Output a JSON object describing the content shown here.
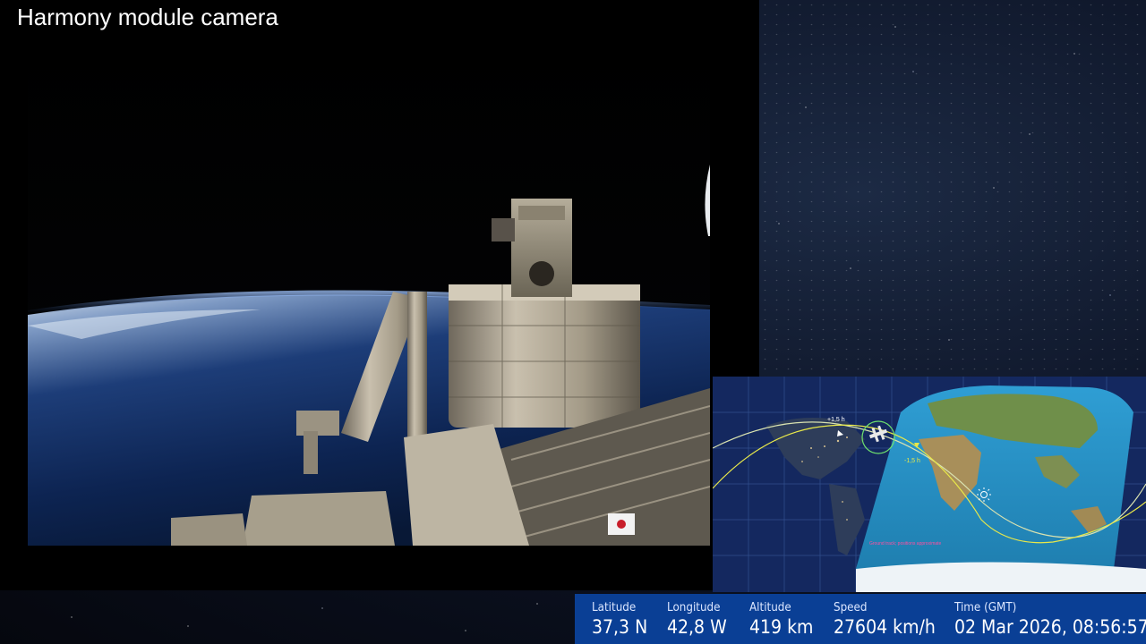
{
  "camera": {
    "title": "Harmony module camera"
  },
  "map": {
    "orbit_marker_ahead": "+1,5 h",
    "orbit_marker_behind": "-1,5 h",
    "footer_note": "Ground track; positions approximate",
    "colors": {
      "ocean_night": "#14285f",
      "ocean_day": "#2a8ec0",
      "past_track": "#d9e2b0",
      "future_track": "#e8e84a",
      "station_ring": "#6ee06e"
    },
    "icons": [
      "station-icon",
      "sun-icon"
    ]
  },
  "telemetry": {
    "latitude_label": "Latitude",
    "latitude_value": "37,3 N",
    "longitude_label": "Longitude",
    "longitude_value": "42,8 W",
    "altitude_label": "Altitude",
    "altitude_value": "419 km",
    "speed_label": "Speed",
    "speed_value": "27604 km/h",
    "time_label": "Time (GMT)",
    "time_value": "02 Mar 2026, 08:56:57",
    "colors": {
      "bar": "#0a3f95",
      "text": "#ffffff"
    }
  }
}
